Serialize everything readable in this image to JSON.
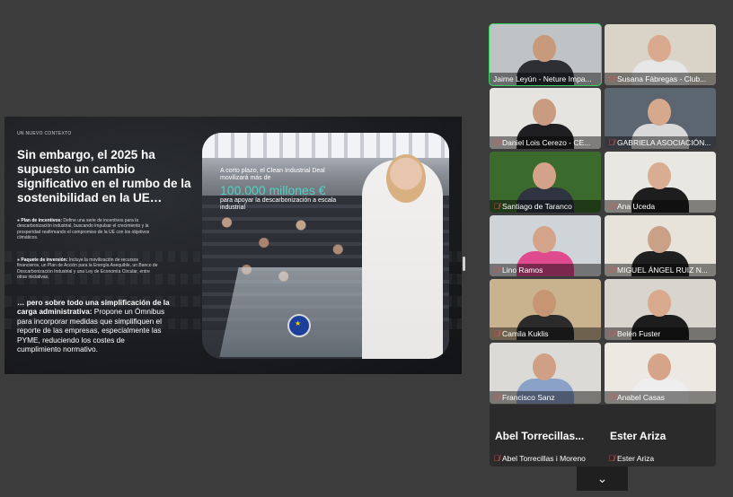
{
  "slide": {
    "kicker": "UN NUEVO CONTEXTO",
    "headline": "Sin embargo, el 2025 ha supuesto un cambio significativo en el rumbo de la sostenibilidad en la UE…",
    "bullets": [
      {
        "title": "Plan de incentivos:",
        "text": "Define una serie de incentivos para la descarbonización industrial, buscando impulsar el crecimiento y la prosperidad reafirmando el compromiso de la UE con los objetivos climáticos."
      },
      {
        "title": "Paquete de inversión:",
        "text": "Incluye la movilización de recursos financieros, un Plan de Acción para la Energía Asequible, un Banco de Descarbonización Industrial y una Ley de Economía Circular, entre otras iniciativas."
      }
    ],
    "bottom_bold": "… pero sobre todo una simplificación de la carga administrativa:",
    "bottom_text": "Propone un Ómnibus para incorporar medidas que simplifiquen el reporte de las empresas, especialmente las PYME, reduciendo los costes de cumplimiento normativo.",
    "quote_top": "A corto plazo, el Clean Industrial Deal movilizará más de",
    "quote_big": "100.000 millones €",
    "quote_bottom": "para apoyar la descarbonización a escala industrial"
  },
  "participants": [
    {
      "name": "Jaime Leyún - Neture Impa...",
      "muted": false,
      "active": true,
      "bg": "#bfc3c6",
      "skin": "#c79a7c",
      "shirt": "#2d2f34"
    },
    {
      "name": "Susana Fábregas - Club...",
      "muted": true,
      "active": false,
      "bg": "#d9d3c8",
      "skin": "#d9a98d",
      "shirt": "#e6e6e6"
    },
    {
      "name": "Daniel Lois Cerezo - CE...",
      "muted": true,
      "active": false,
      "bg": "#e6e4e0",
      "skin": "#c99c82",
      "shirt": "#1f1f22"
    },
    {
      "name": "GABRIELA ASOCIACIÓN...",
      "muted": true,
      "active": false,
      "bg": "#5b6670",
      "skin": "#d6a88c",
      "shirt": "#d9d9d9"
    },
    {
      "name": "Santiago de Taranco",
      "muted": true,
      "active": false,
      "bg": "#3b6b2c",
      "skin": "#d2a38a",
      "shirt": "#2e3440"
    },
    {
      "name": "Ana Uceda",
      "muted": true,
      "active": false,
      "bg": "#e9e7e1",
      "skin": "#d8ad91",
      "shirt": "#1e1e1e"
    },
    {
      "name": "Lino Ramos",
      "muted": true,
      "active": false,
      "bg": "#cfd4d8",
      "skin": "#d3a489",
      "shirt": "#e04a8e"
    },
    {
      "name": "MIGUEL ÁNGEL RUIZ N...",
      "muted": true,
      "active": false,
      "bg": "#e7e3da",
      "skin": "#caa086",
      "shirt": "#1f1f1f"
    },
    {
      "name": "Camila Kuklis",
      "muted": true,
      "active": false,
      "bg": "#c9b38f",
      "skin": "#c89574",
      "shirt": "#2b2b2b"
    },
    {
      "name": "Belén Fuster",
      "muted": true,
      "active": false,
      "bg": "#d8d4ce",
      "skin": "#d9a98d",
      "shirt": "#1d1d1d"
    },
    {
      "name": "Francisco Sanz",
      "muted": true,
      "active": false,
      "bg": "#dcdad6",
      "skin": "#cfa085",
      "shirt": "#8aa2c8"
    },
    {
      "name": "Anabel Casas",
      "muted": true,
      "active": false,
      "bg": "#ece9e3",
      "skin": "#d6a488",
      "shirt": "#eeeeee"
    }
  ],
  "bottom_participants": [
    {
      "display_name": "Abel  Torrecillas...",
      "name": "Abel Torrecillas i Moreno"
    },
    {
      "display_name": "Ester Ariza",
      "name": "Ester Ariza"
    }
  ],
  "icons": {
    "mic_off": "mic-off-icon",
    "scroll": "chevron-down-icon"
  },
  "scroll_glyph": "⌄"
}
